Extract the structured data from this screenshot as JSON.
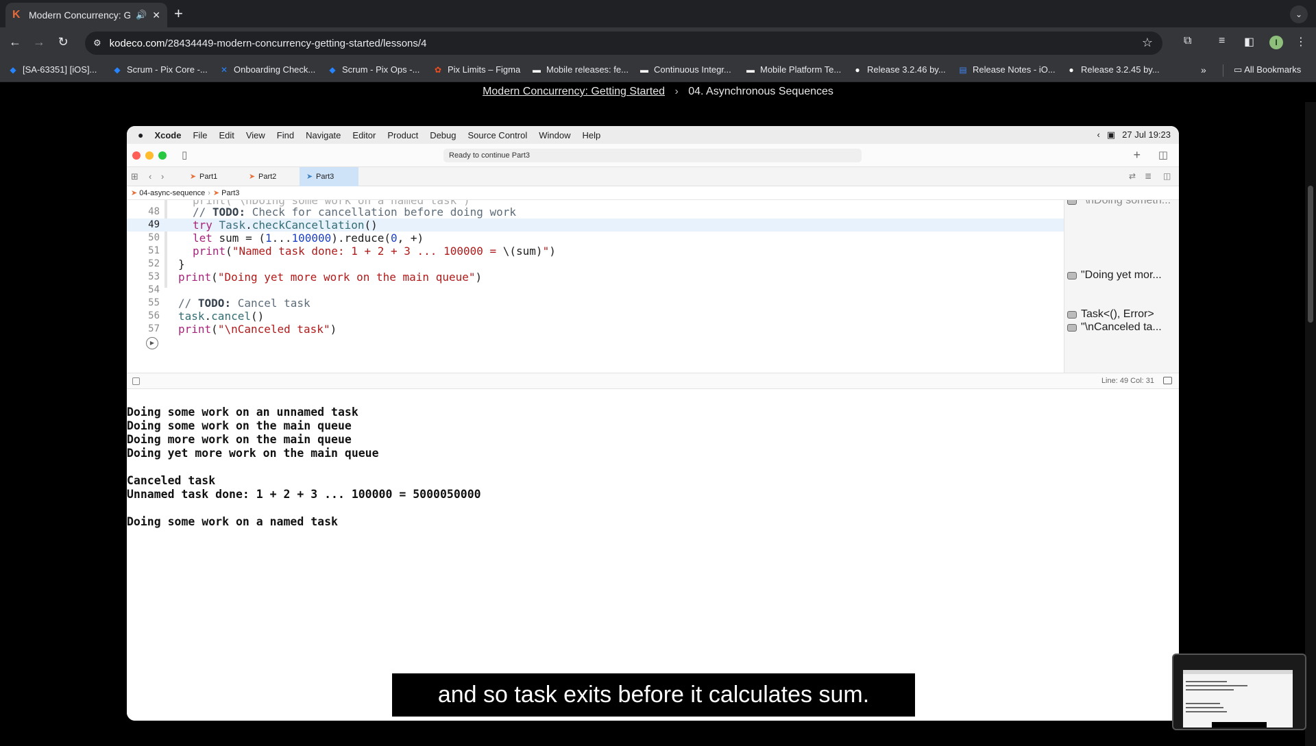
{
  "browser": {
    "tab_title": "Modern Concurrency: Getting Started",
    "url_host": "kodeco.com",
    "url_path": "/28434449-modern-concurrency-getting-started/lessons/4",
    "bookmarks": [
      {
        "label": "[SA-63351] [iOS]...",
        "icon": "jira-icon"
      },
      {
        "label": "Scrum - Pix Core -...",
        "icon": "jira-icon"
      },
      {
        "label": "Onboarding Check...",
        "icon": "confluence-icon"
      },
      {
        "label": "Scrum - Pix Ops -...",
        "icon": "jira-icon"
      },
      {
        "label": "Pix Limits – Figma",
        "icon": "figma-icon"
      },
      {
        "label": "Mobile releases: fe...",
        "icon": "company-icon"
      },
      {
        "label": "Continuous Integr...",
        "icon": "company-icon"
      },
      {
        "label": "Mobile Platform Te...",
        "icon": "company-icon"
      },
      {
        "label": "Release 3.2.46 by...",
        "icon": "github-icon"
      },
      {
        "label": "Release Notes - iO...",
        "icon": "docs-icon"
      },
      {
        "label": "Release 3.2.45 by...",
        "icon": "github-icon"
      }
    ],
    "all_bookmarks": "All Bookmarks",
    "profile_initial": "I"
  },
  "page": {
    "breadcrumb_course": "Modern Concurrency: Getting Started",
    "breadcrumb_lesson": "04. Asynchronous Sequences"
  },
  "mac": {
    "menus": [
      "Xcode",
      "File",
      "Edit",
      "View",
      "Find",
      "Navigate",
      "Editor",
      "Product",
      "Debug",
      "Source Control",
      "Window",
      "Help"
    ],
    "datetime": "27 Jul  19:23"
  },
  "xcode": {
    "status": "Ready to continue Part3",
    "tabs": [
      "Part1",
      "Part2",
      "Part3"
    ],
    "jump_project": "04-async-sequence",
    "jump_file": "Part3",
    "cursor_position": "Line: 49  Col: 31",
    "line_numbers": [
      "48",
      "49",
      "50",
      "51",
      "52",
      "53",
      "54",
      "55",
      "56",
      "57"
    ],
    "results": [
      "\"\\nDoing someth...",
      "\"Doing yet mor...",
      "Task<(), Error>",
      "\"\\nCanceled ta..."
    ]
  },
  "console": {
    "lines": [
      "Doing some work on an unnamed task",
      "Doing some work on the main queue",
      "Doing more work on the main queue",
      "Doing yet more work on the main queue",
      "",
      "Canceled task",
      "Unnamed task done: 1 + 2 + 3 ... 100000 = 5000050000",
      "",
      "Doing some work on a named task"
    ]
  },
  "caption": "and so task exits before it calculates sum."
}
